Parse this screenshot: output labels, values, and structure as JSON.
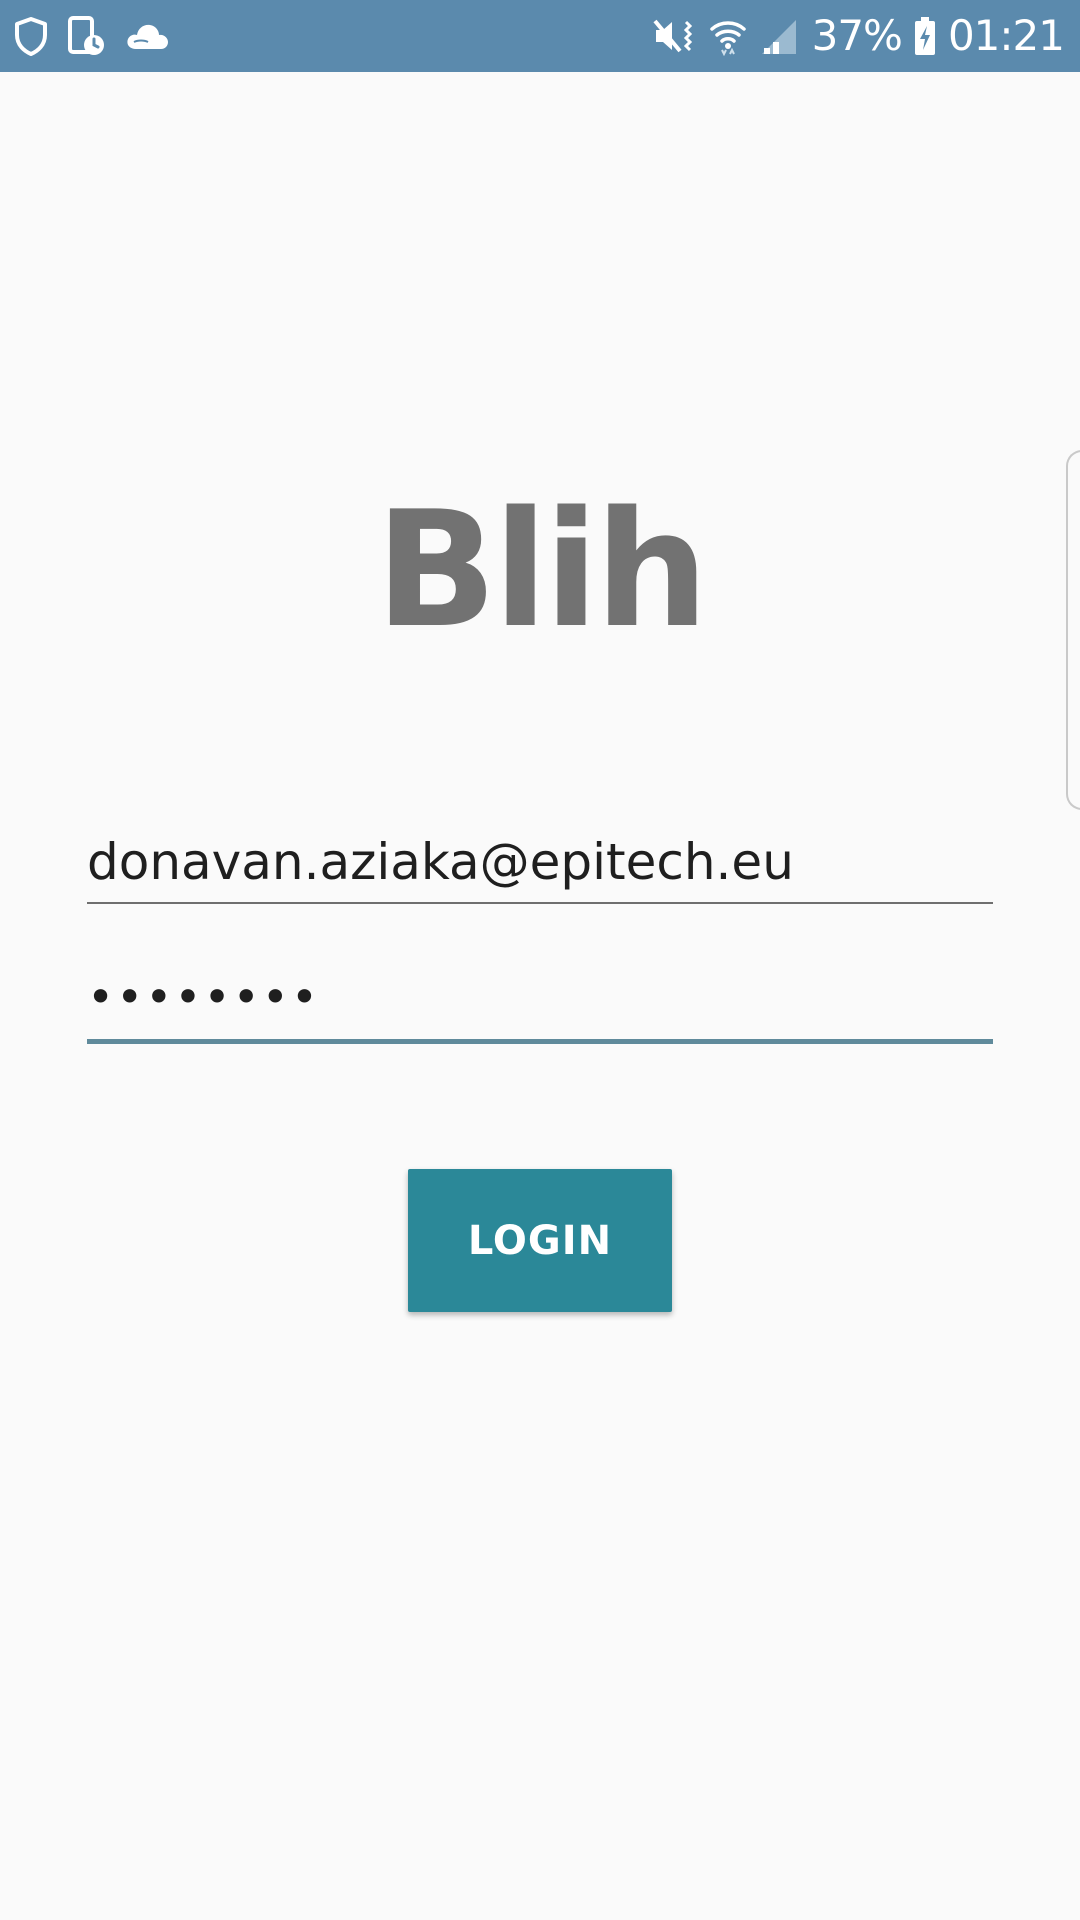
{
  "status_bar": {
    "background": "#5b8aad",
    "left_icons": [
      "shield-icon",
      "device-schedule-icon",
      "cloud-icon"
    ],
    "right_icons": [
      "mute-vibrate-icon",
      "wifi-icon",
      "signal-icon",
      "battery-charging-icon"
    ],
    "battery_percent": "37%",
    "time": "01:21"
  },
  "app": {
    "title": "Blih"
  },
  "form": {
    "email_value": "donavan.aziaka@epitech.eu",
    "password_value": "••••••••",
    "login_label": "LOGIN"
  },
  "colors": {
    "accent": "#2b8898",
    "focus_underline": "#5f8a9b",
    "title_text": "#727272",
    "background": "#fafafa"
  }
}
